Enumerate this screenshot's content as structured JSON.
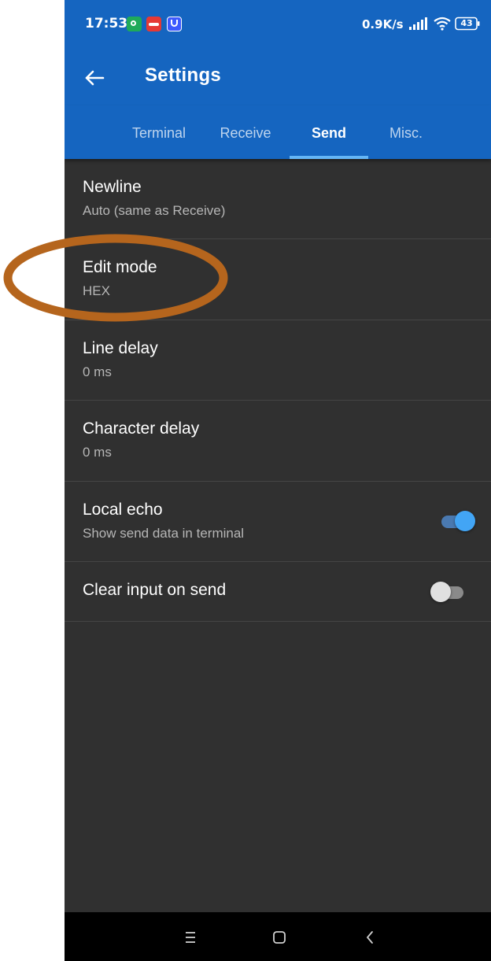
{
  "status_bar": {
    "time": "17:53",
    "network_speed": "0.9K/s",
    "battery_level": "43",
    "icons": [
      "app-notification-icon",
      "app-notification-icon",
      "app-notification-icon",
      "signal-icon",
      "wifi-icon",
      "battery-icon"
    ]
  },
  "app_bar": {
    "back_icon": "arrow-left-icon",
    "title": "Settings"
  },
  "tabs": [
    {
      "label": "Terminal",
      "selected": false
    },
    {
      "label": "Receive",
      "selected": false
    },
    {
      "label": "Send",
      "selected": true
    },
    {
      "label": "Misc.",
      "selected": false
    }
  ],
  "preferences": [
    {
      "title": "Newline",
      "summary": "Auto (same as Receive)"
    },
    {
      "title": "Edit mode",
      "summary": "HEX"
    },
    {
      "title": "Line delay",
      "summary": "0 ms"
    },
    {
      "title": "Character delay",
      "summary": "0 ms"
    },
    {
      "title": "Local echo",
      "summary": "Show send data in terminal",
      "toggle_on": true
    },
    {
      "title": "Clear input on send",
      "toggle_on": false
    }
  ],
  "nav_bar": {
    "icons": [
      "menu-icon",
      "home-icon",
      "back-icon"
    ]
  },
  "colors": {
    "primary": "#1565c0",
    "background": "#303030",
    "tab_indicator": "#64b5f6",
    "toggle_on": "#42a5f5",
    "annotation": "#b5651d"
  }
}
